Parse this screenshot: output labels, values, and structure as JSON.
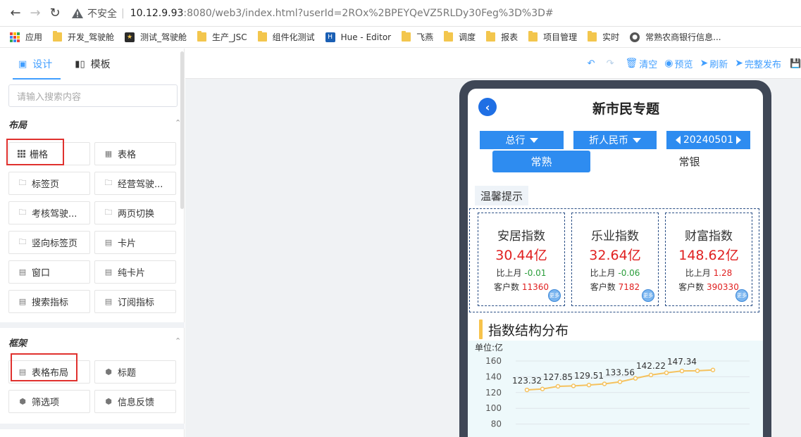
{
  "browser": {
    "insecure_label": "不安全",
    "url_host": "10.12.9.93",
    "url_rest": ":8080/web3/index.html?userId=2ROx%2BPEYQeVZ5RLDy30Feg%3D%3D#"
  },
  "bookmarks": [
    {
      "label": "应用",
      "icon": "apps-icon"
    },
    {
      "label": "开发_驾驶舱",
      "icon": "folder-icon"
    },
    {
      "label": "测试_驾驶舱",
      "icon": "site-icon",
      "color": "#2b2b2b"
    },
    {
      "label": "生产_JSC",
      "icon": "folder-icon"
    },
    {
      "label": "组件化测试",
      "icon": "folder-icon"
    },
    {
      "label": "Hue - Editor",
      "icon": "hue-icon",
      "color": "#1a5fb4"
    },
    {
      "label": "飞燕",
      "icon": "folder-icon"
    },
    {
      "label": "调度",
      "icon": "folder-icon"
    },
    {
      "label": "报表",
      "icon": "folder-icon"
    },
    {
      "label": "项目管理",
      "icon": "folder-icon"
    },
    {
      "label": "实时",
      "icon": "folder-icon"
    },
    {
      "label": "常熟农商银行信息...",
      "icon": "globe-icon",
      "color": "#555555"
    }
  ],
  "left_panel": {
    "tabs": [
      {
        "label": "设计",
        "icon": "design-icon"
      },
      {
        "label": "模板",
        "icon": "template-icon"
      }
    ],
    "search_placeholder": "请输入搜索内容",
    "layout_section": "布局",
    "layout_items": [
      "栅格",
      "表格",
      "标签页",
      "经营驾驶...",
      "考核驾驶...",
      "两页切换",
      "竖向标签页",
      "卡片",
      "窗口",
      "纯卡片",
      "搜索指标",
      "订阅指标"
    ],
    "frame_section": "框架",
    "frame_items": [
      "表格布局",
      "标题",
      "筛选项",
      "信息反馈"
    ]
  },
  "toolbar": {
    "undo": "undo-icon",
    "redo": "redo-icon",
    "clear": "清空",
    "preview": "预览",
    "refresh": "刷新",
    "publish": "完整发布"
  },
  "phone": {
    "title": "新市民专题",
    "dropdowns": [
      "总行",
      "折人民币"
    ],
    "date": "20240501",
    "city_tabs": [
      "常熟",
      "常银"
    ],
    "tips": "温馨提示",
    "cards": [
      {
        "title": "安居指数",
        "value": "30.44亿",
        "mom_label": "比上月",
        "mom": "-0.01",
        "mom_color": "#2a9d3a",
        "cust_label": "客户数",
        "cust": "11360"
      },
      {
        "title": "乐业指数",
        "value": "32.64亿",
        "mom_label": "比上月",
        "mom": "-0.06",
        "mom_color": "#2a9d3a",
        "cust_label": "客户数",
        "cust": "7182"
      },
      {
        "title": "财富指数",
        "value": "148.62亿",
        "mom_label": "比上月",
        "mom": "1.28",
        "mom_color": "#e02020",
        "cust_label": "客户数",
        "cust": "390330"
      }
    ],
    "more_label": "更多",
    "section_title": "指数结构分布"
  },
  "chart_data": {
    "type": "line",
    "ylabel": "单位:亿",
    "ylim": [
      80,
      160
    ],
    "yticks": [
      80,
      100,
      120,
      140,
      160
    ],
    "series": [
      {
        "values": [
          123.32,
          124.5,
          127.85,
          128.4,
          129.51,
          131.0,
          133.56,
          138.0,
          142.22,
          145.0,
          147.34,
          147.6,
          148.62
        ],
        "labels": [
          "123.32",
          "",
          "127.85",
          "",
          "129.51",
          "",
          "133.56",
          "",
          "142.22",
          "",
          "147.34",
          "",
          ""
        ],
        "color": "#f5c25e"
      }
    ],
    "grid": true
  }
}
